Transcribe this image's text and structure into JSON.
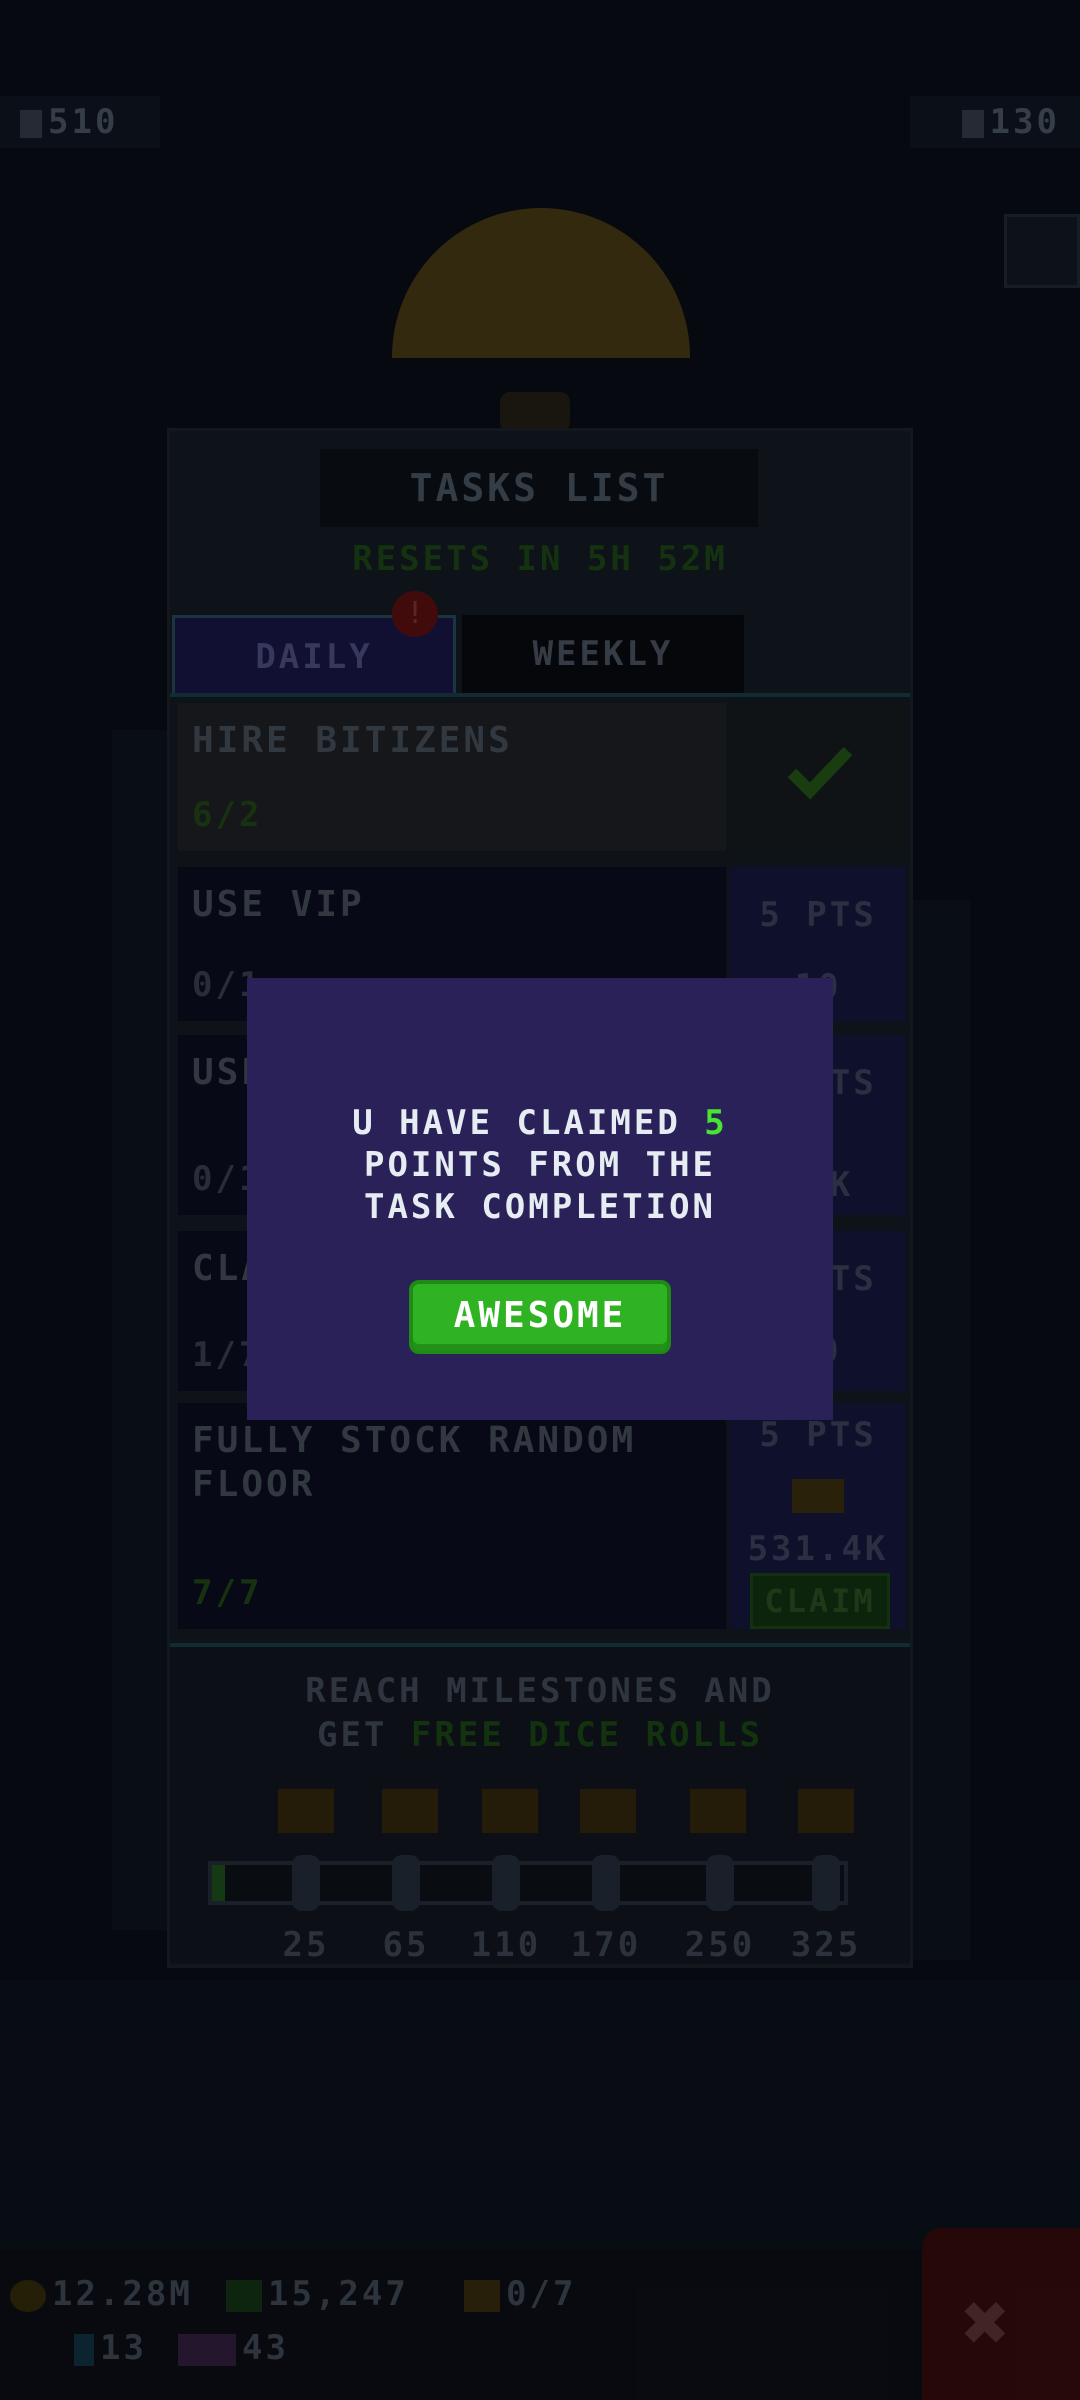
{
  "hud": {
    "coins_top": "510",
    "bux_top": "130"
  },
  "panel": {
    "title": "TASKS LIST",
    "reset_text": "RESETS IN 5H 52M",
    "tabs": [
      {
        "label": "DAILY",
        "badge": "!"
      },
      {
        "label": "WEEKLY"
      }
    ],
    "tasks": [
      {
        "name": "HIRE BITIZENS",
        "progress": "6/2",
        "completed": true
      },
      {
        "name": "USE VIP",
        "progress": "0/1",
        "pts": "5 PTS",
        "reward": "10"
      },
      {
        "name": "USE",
        "progress": "0/1",
        "pts": "5 PTS",
        "reward": "14K"
      },
      {
        "name": "CLA",
        "progress": "1/7",
        "pts": "5 PTS",
        "reward": "10"
      },
      {
        "name": "FULLY STOCK RANDOM FLOOR",
        "progress": "7/7",
        "pts": "5 PTS",
        "reward": "531.4K",
        "claim_label": "CLAIM"
      }
    ],
    "milestones": {
      "text_before": "REACH MILESTONES AND",
      "text_get": "GET",
      "text_highlight": "FREE DICE ROLLS",
      "labels": [
        "25",
        "65",
        "110",
        "170",
        "250",
        "325"
      ],
      "progress_fraction": 0.02
    }
  },
  "bottom": {
    "coins": "12.28M",
    "bux": "15,247",
    "tickets": "0/7",
    "gems": "13",
    "level": "43"
  },
  "modal": {
    "line1_prefix": "U HAVE CLAIMED",
    "points": "5",
    "line2": "POINTS FROM THE",
    "line3": "TASK COMPLETION",
    "button_label": "AWESOME"
  },
  "colors": {
    "modal_bg": "#2a2158",
    "button_green": "#2fb322",
    "highlight_green": "#47e52f"
  }
}
